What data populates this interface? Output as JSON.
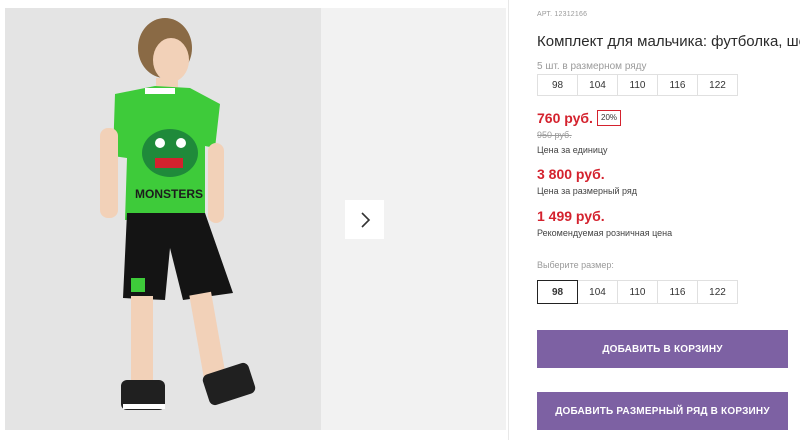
{
  "product": {
    "sku": "АРТ. 12312166",
    "title": "Комплект для мальчика: футболка, шорты",
    "pack_note": "5 шт. в размерном ряду",
    "pack_sizes": [
      "98",
      "104",
      "110",
      "116",
      "122"
    ],
    "unit_price": "760 руб.",
    "discount": "20%",
    "old_price": "950 руб.",
    "unit_price_caption": "Цена за единицу",
    "row_price": "3 800 руб.",
    "row_price_caption": "Цена за размерный ряд",
    "retail_price": "1 499 руб.",
    "retail_price_caption": "Рекомендуемая розничная цена",
    "select_size_label": "Выберите размер:",
    "select_sizes": [
      "98",
      "104",
      "110",
      "116",
      "122"
    ],
    "selected_size": "98",
    "add_to_cart_label": "ДОБАВИТЬ В КОРЗИНУ",
    "add_row_to_cart_label": "ДОБАВИТЬ РАЗМЕРНЫЙ РЯД В КОРЗИНУ"
  },
  "gallery": {
    "next_icon": "chevron-right-icon",
    "tshirt_print": "MONSTERS"
  },
  "colors": {
    "accent_button": "#7d61a3",
    "price_red": "#d4222e"
  }
}
